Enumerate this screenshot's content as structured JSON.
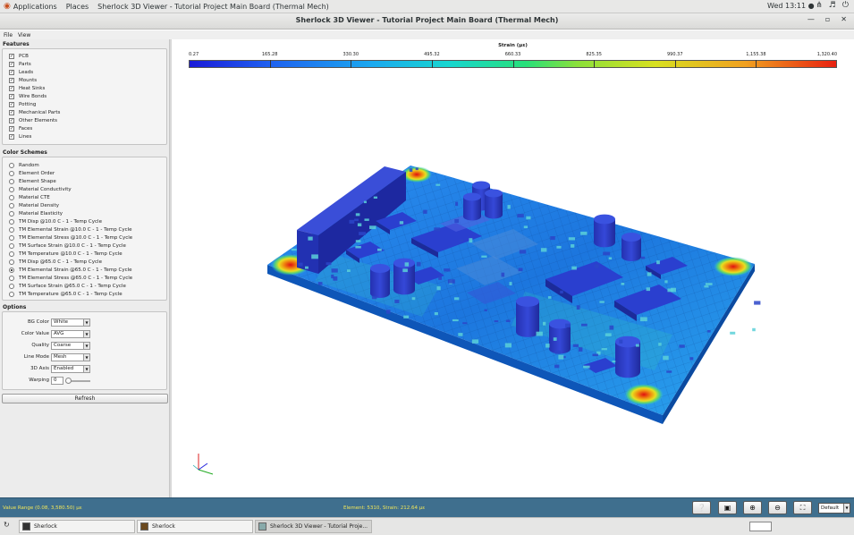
{
  "topbar": {
    "applications": "Applications",
    "places": "Places",
    "window_title": "Sherlock 3D Viewer - Tutorial Project Main Board (Thermal Mech)",
    "clock": "Wed 13:11 ●"
  },
  "window": {
    "title": "Sherlock 3D Viewer - Tutorial Project Main Board (Thermal Mech)"
  },
  "menu": {
    "file": "File",
    "view": "View"
  },
  "features": {
    "title": "Features",
    "items": [
      "PCB",
      "Parts",
      "Leads",
      "Mounts",
      "Heat Sinks",
      "Wire Bonds",
      "Potting",
      "Mechanical Parts",
      "Other Elements",
      "Faces",
      "Lines"
    ]
  },
  "color_schemes": {
    "title": "Color Schemes",
    "items": [
      "Random",
      "Element Order",
      "Element Shape",
      "Material Conductivity",
      "Material CTE",
      "Material Density",
      "Material Elasticity",
      "TM Disp @10.0 C - 1 - Temp Cycle",
      "TM Elemental Strain @10.0 C - 1 - Temp Cycle",
      "TM Elemental Stress @10.0 C - 1 - Temp Cycle",
      "TM Surface Strain @10.0 C - 1 - Temp Cycle",
      "TM Temperature @10.0 C - 1 - Temp Cycle",
      "TM Disp @65.0 C - 1 - Temp Cycle",
      "TM Elemental Strain @65.0 C - 1 - Temp Cycle",
      "TM Elemental Stress @65.0 C - 1 - Temp Cycle",
      "TM Surface Strain @65.0 C - 1 - Temp Cycle",
      "TM Temperature @65.0 C - 1 - Temp Cycle"
    ],
    "selected_index": 13
  },
  "options": {
    "title": "Options",
    "bg_color": {
      "label": "BG Color",
      "value": "White"
    },
    "color_value": {
      "label": "Color Value",
      "value": "AVG"
    },
    "quality": {
      "label": "Quality",
      "value": "Coarse"
    },
    "line_mode": {
      "label": "Line Mode",
      "value": "Mesh"
    },
    "axis_3d": {
      "label": "3D Axis",
      "value": "Enabled"
    },
    "warping": {
      "label": "Warping",
      "value": "0"
    },
    "refresh": "Refresh"
  },
  "legend": {
    "title": "Strain (µε)",
    "ticks": [
      "0.27",
      "165.28",
      "330.30",
      "495.32",
      "660.33",
      "825.35",
      "990.37",
      "1,155.38",
      "1,320.40"
    ]
  },
  "status": {
    "value_range": "Value Range (0.08, 3,580.50) µε",
    "element_info": "Element: 5310, Strain: 212.64 µε",
    "view_select": "Default",
    "buttons": [
      "help-icon",
      "camera-icon",
      "zoom-in-icon",
      "zoom-out-icon",
      "zoom-fit-icon"
    ]
  },
  "taskbar": {
    "items": [
      "Sherlock",
      "Sherlock",
      "Sherlock 3D Viewer - Tutorial Proje..."
    ]
  },
  "colors": {
    "status_bar": "#3f6f8e",
    "status_text": "#f1e65a",
    "pcb_base": "#1e7fe0",
    "part_blue": "#2a3fcf"
  }
}
